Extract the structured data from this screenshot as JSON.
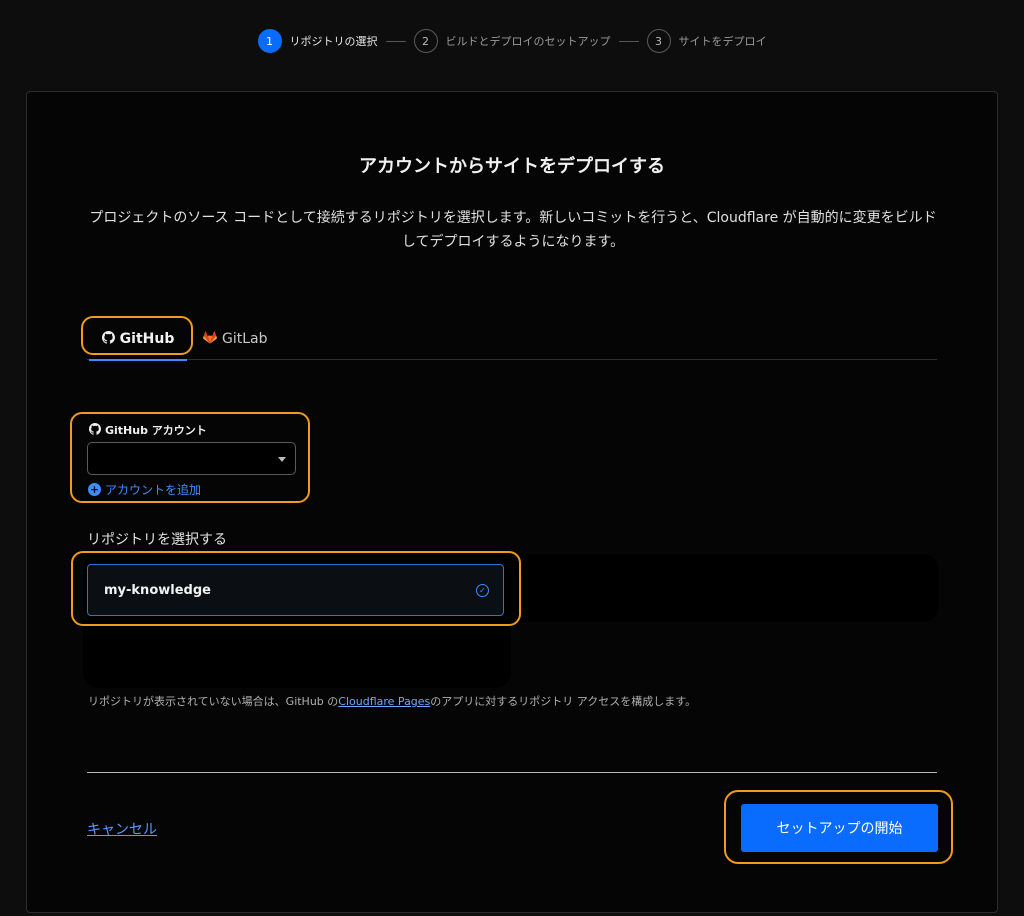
{
  "stepper": {
    "steps": [
      {
        "num": "1",
        "label": "リポジトリの選択"
      },
      {
        "num": "2",
        "label": "ビルドとデプロイのセットアップ"
      },
      {
        "num": "3",
        "label": "サイトをデプロイ"
      }
    ],
    "active_step": 1
  },
  "card": {
    "title": "アカウントからサイトをデプロイする",
    "description": "プロジェクトのソース コードとして接続するリポジトリを選択します。新しいコミットを行うと、Cloudflare が自動的に変更をビルドしてデプロイするようになります。"
  },
  "tabs": {
    "github": "GitHub",
    "gitlab": "GitLab",
    "selected": "GitHub"
  },
  "account": {
    "label": "GitHub アカウント",
    "selected_value": "",
    "add_label": "アカウントを追加"
  },
  "repo": {
    "heading": "リポジトリを選択する",
    "selected": "my-knowledge",
    "note_prefix": "リポジトリが表示されていない場合は、GitHub の",
    "note_link": "Cloudflare Pages",
    "note_suffix": "のアプリに対するリポジトリ アクセスを構成します。"
  },
  "footer": {
    "cancel": "キャンセル",
    "start": "セットアップの開始"
  },
  "colors": {
    "accent": "#0a6cff",
    "highlight": "#f29a1b",
    "gitlab": "#fc6d26"
  },
  "icons": {
    "github": "github-icon",
    "gitlab": "gitlab-icon",
    "add": "plus-circle-icon",
    "check": "check-circle-icon",
    "caret": "chevron-down-icon"
  }
}
